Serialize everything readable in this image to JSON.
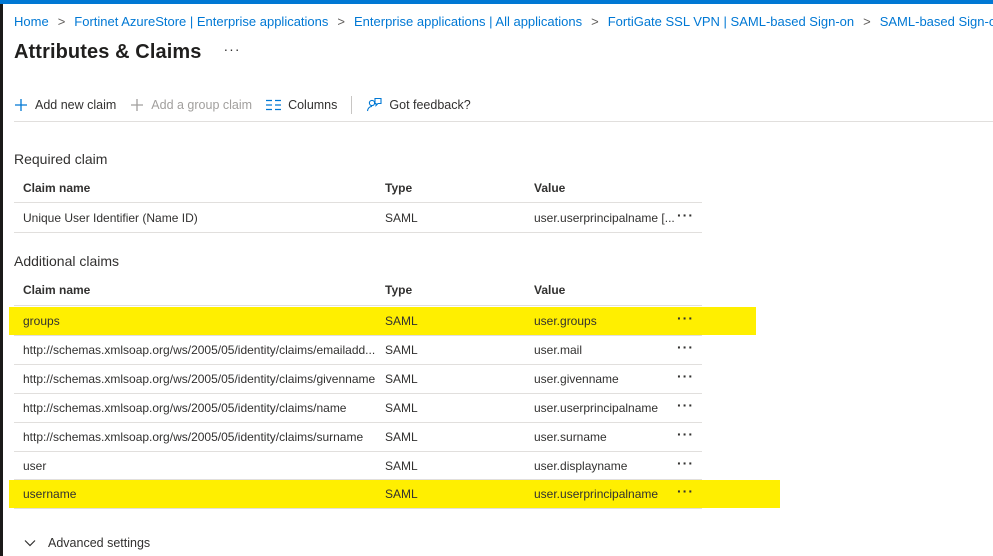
{
  "breadcrumb": [
    "Home",
    "Fortinet AzureStore | Enterprise applications",
    "Enterprise applications | All applications",
    "FortiGate SSL VPN | SAML-based Sign-on",
    "SAML-based Sign-on"
  ],
  "breadcrumb_separator": ">",
  "page": {
    "title": "Attributes & Claims",
    "more": "···"
  },
  "toolbar": {
    "add_new_claim": "Add new claim",
    "add_group_claim": "Add a group claim",
    "columns": "Columns",
    "feedback": "Got feedback?"
  },
  "required": {
    "title": "Required claim",
    "headers": {
      "name": "Claim name",
      "type": "Type",
      "value": "Value"
    },
    "rows": [
      {
        "name": "Unique User Identifier (Name ID)",
        "type": "SAML",
        "value": "user.userprincipalname [..."
      }
    ]
  },
  "additional": {
    "title": "Additional claims",
    "headers": {
      "name": "Claim name",
      "type": "Type",
      "value": "Value"
    },
    "rows": [
      {
        "name": "groups",
        "type": "SAML",
        "value": "user.groups"
      },
      {
        "name": "http://schemas.xmlsoap.org/ws/2005/05/identity/claims/emailadd...",
        "type": "SAML",
        "value": "user.mail"
      },
      {
        "name": "http://schemas.xmlsoap.org/ws/2005/05/identity/claims/givenname",
        "type": "SAML",
        "value": "user.givenname"
      },
      {
        "name": "http://schemas.xmlsoap.org/ws/2005/05/identity/claims/name",
        "type": "SAML",
        "value": "user.userprincipalname"
      },
      {
        "name": "http://schemas.xmlsoap.org/ws/2005/05/identity/claims/surname",
        "type": "SAML",
        "value": "user.surname"
      },
      {
        "name": "user",
        "type": "SAML",
        "value": "user.displayname"
      },
      {
        "name": "username",
        "type": "SAML",
        "value": "user.userprincipalname"
      }
    ]
  },
  "row_more": "···",
  "advanced_settings": "Advanced settings",
  "colors": {
    "accent": "#0078d4",
    "highlight": "#ffef00",
    "text": "#323130"
  }
}
